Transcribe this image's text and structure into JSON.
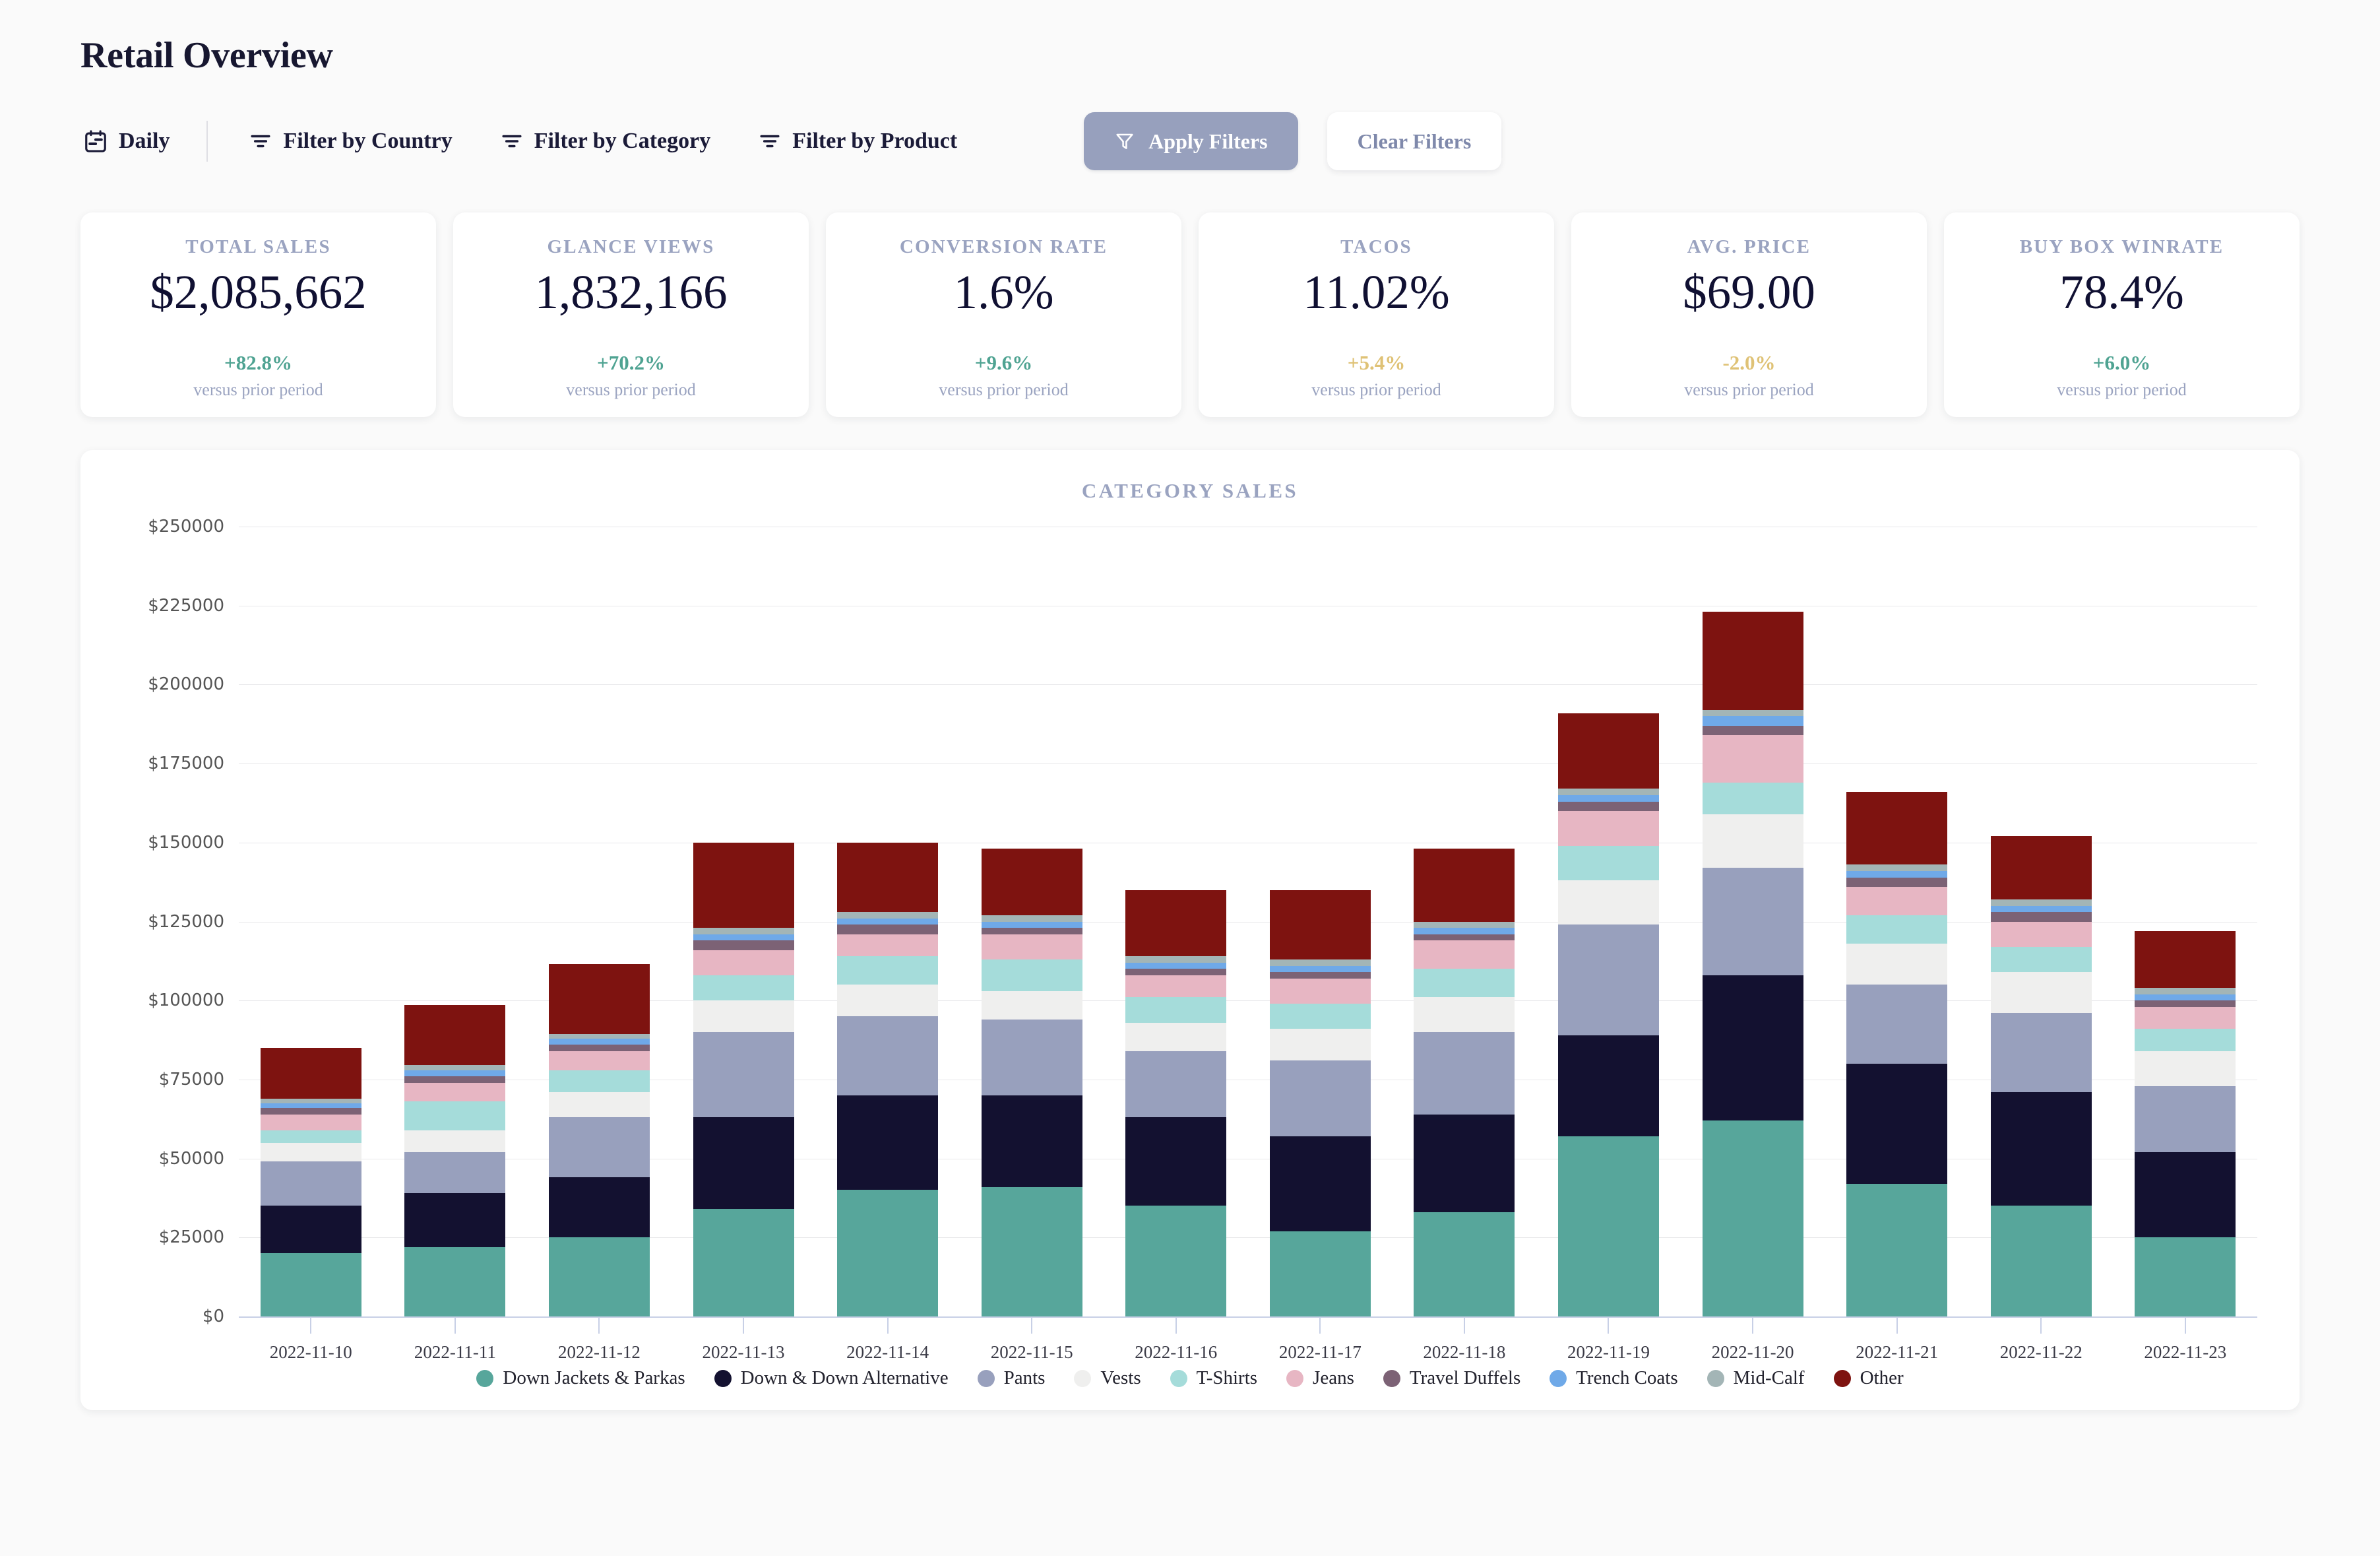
{
  "header": {
    "title": "Retail Overview",
    "granularity_label": "Daily",
    "filters": [
      {
        "label": "Filter by Country",
        "icon": "filter-icon"
      },
      {
        "label": "Filter by Category",
        "icon": "filter-icon"
      },
      {
        "label": "Filter by Product",
        "icon": "filter-icon"
      }
    ],
    "apply_label": "Apply Filters",
    "clear_label": "Clear Filters",
    "apply_bg": "#97A0BD",
    "clear_fg": "#7F89AB"
  },
  "kpis": [
    {
      "label": "TOTAL SALES",
      "value": "$2,085,662",
      "delta": "+82.8%",
      "delta_kind": "up",
      "sub": "versus prior period"
    },
    {
      "label": "GLANCE VIEWS",
      "value": "1,832,166",
      "delta": "+70.2%",
      "delta_kind": "up",
      "sub": "versus prior period"
    },
    {
      "label": "CONVERSION RATE",
      "value": "1.6%",
      "delta": "+9.6%",
      "delta_kind": "up",
      "sub": "versus prior period"
    },
    {
      "label": "TACOS",
      "value": "11.02%",
      "delta": "+5.4%",
      "delta_kind": "flat",
      "sub": "versus prior period"
    },
    {
      "label": "AVG. PRICE",
      "value": "$69.00",
      "delta": "-2.0%",
      "delta_kind": "flat",
      "sub": "versus prior period"
    },
    {
      "label": "BUY BOX WINRATE",
      "value": "78.4%",
      "delta": "+6.0%",
      "delta_kind": "up",
      "sub": "versus prior period"
    }
  ],
  "chart_data": {
    "type": "bar",
    "stacked": true,
    "title": "CATEGORY SALES",
    "xlabel": "",
    "ylabel": "",
    "ylim": [
      0,
      250000
    ],
    "grid": true,
    "legend_position": "bottom",
    "ytick_labels": [
      "$250000",
      "$225000",
      "$200000",
      "$175000",
      "$150000",
      "$125000",
      "$100000",
      "$75000",
      "$50000",
      "$25000",
      "$0"
    ],
    "ytick_values": [
      250000,
      225000,
      200000,
      175000,
      150000,
      125000,
      100000,
      75000,
      50000,
      25000,
      0
    ],
    "categories": [
      "2022-11-10",
      "2022-11-11",
      "2022-11-12",
      "2022-11-13",
      "2022-11-14",
      "2022-11-15",
      "2022-11-16",
      "2022-11-17",
      "2022-11-18",
      "2022-11-19",
      "2022-11-20",
      "2022-11-21",
      "2022-11-22",
      "2022-11-23"
    ],
    "series": [
      {
        "name": "Down Jackets & Parkas",
        "color": "#57A69B",
        "values": [
          20000,
          22000,
          25000,
          34000,
          40000,
          41000,
          35000,
          27000,
          33000,
          57000,
          62000,
          42000,
          35000,
          25000
        ]
      },
      {
        "name": "Down & Down Alternative",
        "color": "#131130",
        "values": [
          15000,
          17000,
          19000,
          29000,
          30000,
          29000,
          28000,
          30000,
          31000,
          32000,
          46000,
          38000,
          36000,
          27000
        ]
      },
      {
        "name": "Pants",
        "color": "#98A0BD",
        "values": [
          14000,
          13000,
          19000,
          27000,
          25000,
          24000,
          21000,
          24000,
          26000,
          35000,
          34000,
          25000,
          25000,
          21000
        ]
      },
      {
        "name": "Vests",
        "color": "#EFEFEE",
        "values": [
          6000,
          7000,
          8000,
          10000,
          10000,
          9000,
          9000,
          10000,
          11000,
          14000,
          17000,
          13000,
          13000,
          11000
        ]
      },
      {
        "name": "T-Shirts",
        "color": "#A5DCDA",
        "values": [
          4000,
          9000,
          7000,
          8000,
          9000,
          10000,
          8000,
          8000,
          9000,
          11000,
          10000,
          9000,
          8000,
          7000
        ]
      },
      {
        "name": "Jeans",
        "color": "#E7B6C3",
        "values": [
          5000,
          6000,
          6000,
          8000,
          7000,
          8000,
          7000,
          8000,
          9000,
          11000,
          15000,
          9000,
          8000,
          7000
        ]
      },
      {
        "name": "Travel Duffels",
        "color": "#7C6275",
        "values": [
          2000,
          2000,
          2000,
          3000,
          3000,
          2000,
          2000,
          2000,
          2000,
          3000,
          3000,
          3000,
          3000,
          2000
        ]
      },
      {
        "name": "Trench Coats",
        "color": "#6FA9E8",
        "values": [
          1500,
          2000,
          2000,
          2000,
          2000,
          2000,
          2000,
          2000,
          2000,
          2000,
          3000,
          2000,
          2000,
          2000
        ]
      },
      {
        "name": "Mid-Calf",
        "color": "#A3B5B6",
        "values": [
          1500,
          1500,
          1500,
          2000,
          2000,
          2000,
          2000,
          2000,
          2000,
          2000,
          2000,
          2000,
          2000,
          2000
        ]
      },
      {
        "name": "Other",
        "color": "#7E1310",
        "values": [
          16000,
          19000,
          22000,
          27000,
          22000,
          21000,
          21000,
          22000,
          23000,
          24000,
          31000,
          23000,
          20000,
          18000
        ]
      }
    ]
  }
}
